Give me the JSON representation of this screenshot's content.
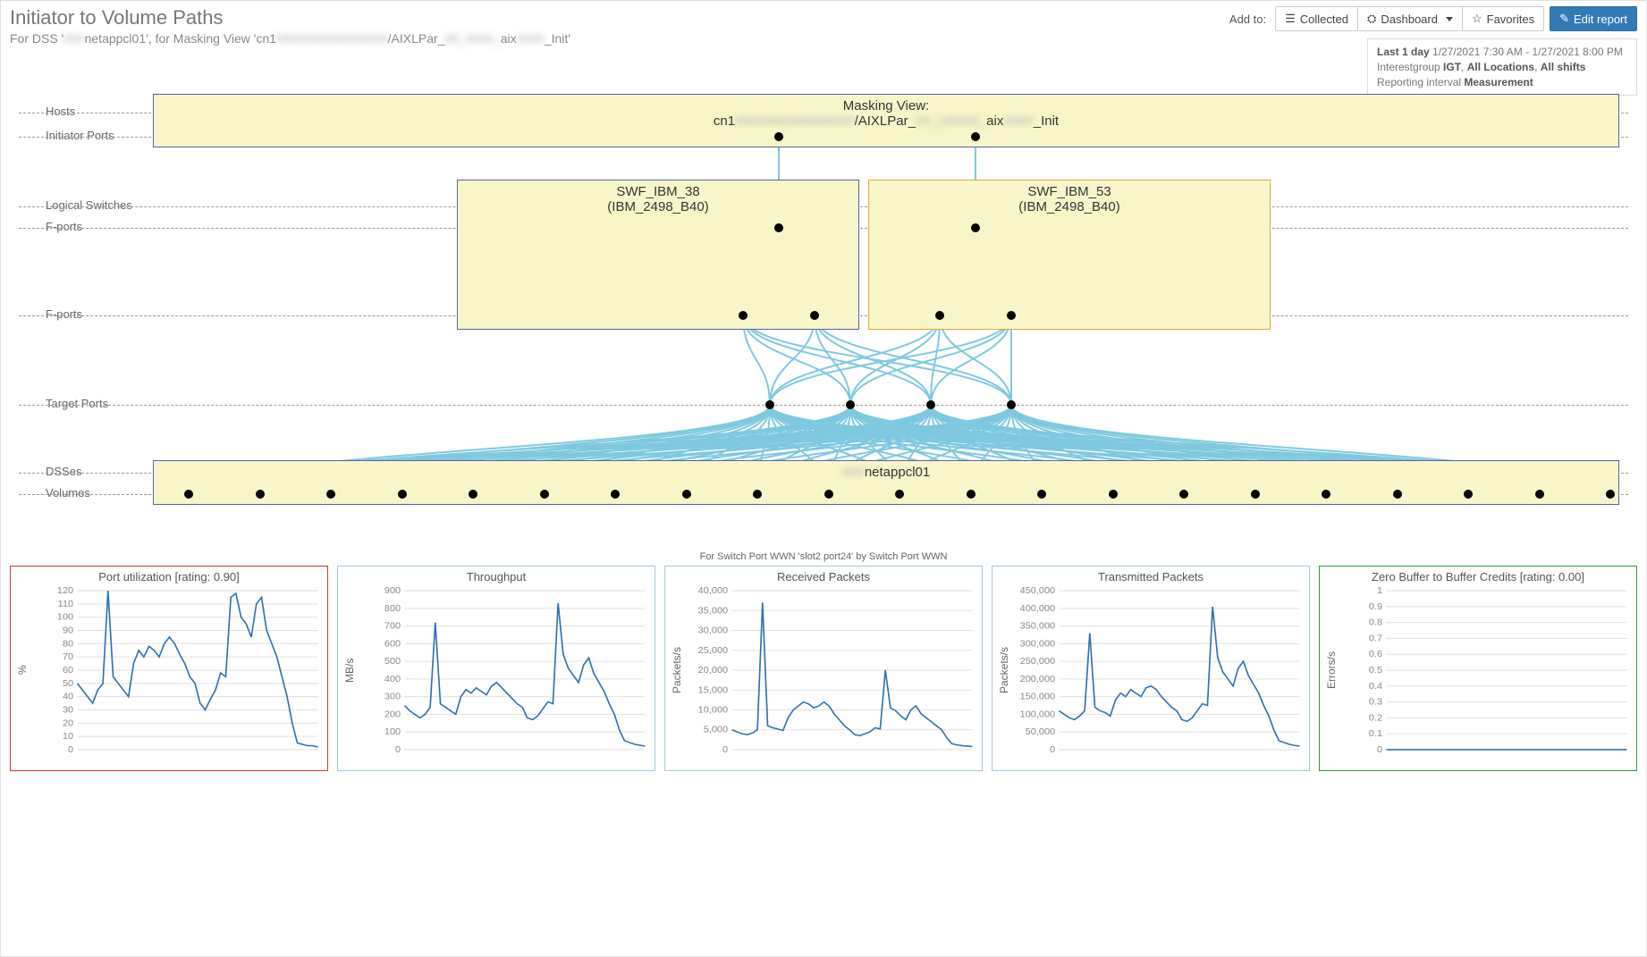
{
  "header": {
    "title": "Initiator to Volume Paths",
    "subtitle_prefix": "For DSS '",
    "subtitle_dss_blur": "###",
    "subtitle_dss": "netappcl01",
    "subtitle_mid": "', for Masking View 'cn1",
    "subtitle_mv_blur": "################",
    "subtitle_mv_mid": "/AIXLPar_",
    "subtitle_mv_blur2": "##_####_",
    "subtitle_mv_mid2": "aix",
    "subtitle_mv_blur3": "####",
    "subtitle_end": "_Init'",
    "addto": "Add to:",
    "btn_collected": "Collected",
    "btn_dashboard": "Dashboard",
    "btn_favorites": "Favorites",
    "btn_edit": "Edit report"
  },
  "info": {
    "l1_a": "Last 1 day ",
    "l1_b": "1/27/2021 7:30 AM - 1/27/2021 8:00 PM",
    "l2_a": "Interestgroup ",
    "l2_b": "IGT",
    "l2_c": ", ",
    "l2_d": "All Locations",
    "l2_e": ", ",
    "l2_f": "All shifts",
    "l3_a": "Reporting interval ",
    "l3_b": "Measurement"
  },
  "topology": {
    "rows": {
      "hosts": "Hosts",
      "initports": "Initiator Ports",
      "logsw": "Logical Switches",
      "fports1": "F-ports",
      "fports2": "F-ports",
      "tgtports": "Target Ports",
      "dsses": "DSSes",
      "volumes": "Volumes"
    },
    "mv_title": "Masking View:",
    "mv_name_a": "cn1",
    "mv_name_blur": "################",
    "mv_name_b": "/AIXLPar_",
    "mv_name_blur2": "##_U###A_",
    "mv_name_c": "aix",
    "mv_name_blur3": "####",
    "mv_name_d": "_Init",
    "sw1_a": "SWF_IBM_38",
    "sw1_b": "(IBM_2498_B40)",
    "sw2_a": "SWF_IBM_53",
    "sw2_b": "(IBM_2498_B40)",
    "dss_blur": "###",
    "dss": "netappcl01",
    "counts": {
      "initiator_ports": 2,
      "switches": 2,
      "fports_upper": 2,
      "fports_lower": 4,
      "target_ports": 4,
      "volumes": 21
    }
  },
  "chart_strip_header": "For Switch Port WWN 'slot2 port24' by Switch Port WWN",
  "chart_data": [
    {
      "type": "line",
      "title": "Port utilization [rating: 0.90]",
      "ylabel": "%",
      "ylim": [
        0,
        120
      ],
      "yticks": [
        0,
        10,
        20,
        30,
        40,
        50,
        60,
        70,
        80,
        90,
        100,
        110,
        120
      ],
      "border": "red",
      "values": [
        50,
        45,
        40,
        35,
        45,
        50,
        120,
        55,
        50,
        45,
        40,
        65,
        75,
        70,
        78,
        75,
        70,
        80,
        85,
        80,
        72,
        65,
        55,
        50,
        35,
        30,
        38,
        45,
        58,
        55,
        115,
        118,
        100,
        95,
        85,
        110,
        115,
        90,
        80,
        70,
        55,
        40,
        20,
        5,
        4,
        3,
        3,
        2
      ]
    },
    {
      "type": "line",
      "title": "Throughput",
      "ylabel": "MB/s",
      "ylim": [
        0,
        900
      ],
      "yticks": [
        0,
        100,
        200,
        300,
        400,
        500,
        600,
        700,
        800,
        900
      ],
      "border": "blue",
      "values": [
        250,
        220,
        200,
        180,
        200,
        240,
        720,
        260,
        240,
        220,
        200,
        300,
        340,
        320,
        350,
        330,
        310,
        360,
        380,
        350,
        320,
        290,
        260,
        240,
        180,
        170,
        190,
        230,
        270,
        260,
        830,
        540,
        460,
        420,
        380,
        480,
        520,
        430,
        380,
        330,
        260,
        200,
        110,
        50,
        40,
        30,
        25,
        20
      ]
    },
    {
      "type": "line",
      "title": "Received Packets",
      "ylabel": "Packets/s",
      "ylim": [
        0,
        40000
      ],
      "yticks": [
        0,
        5000,
        10000,
        15000,
        20000,
        25000,
        30000,
        35000,
        40000
      ],
      "border": "blue",
      "values": [
        5000,
        4500,
        4000,
        3800,
        4200,
        5000,
        37000,
        6000,
        5500,
        5200,
        4800,
        8000,
        10000,
        11000,
        12000,
        11500,
        10500,
        11000,
        12000,
        11000,
        9000,
        7500,
        6000,
        5000,
        3800,
        3500,
        4000,
        4500,
        5500,
        5200,
        20000,
        10500,
        9800,
        8500,
        7500,
        10000,
        11000,
        9000,
        8000,
        7000,
        6000,
        5000,
        3000,
        1500,
        1200,
        1000,
        900,
        800
      ]
    },
    {
      "type": "line",
      "title": "Transmitted Packets",
      "ylabel": "Packets/s",
      "ylim": [
        0,
        450000
      ],
      "yticks": [
        0,
        50000,
        100000,
        150000,
        200000,
        250000,
        300000,
        350000,
        400000,
        450000
      ],
      "border": "blue",
      "values": [
        110000,
        100000,
        90000,
        85000,
        95000,
        110000,
        330000,
        120000,
        110000,
        105000,
        95000,
        140000,
        160000,
        150000,
        170000,
        160000,
        150000,
        175000,
        180000,
        170000,
        150000,
        135000,
        120000,
        110000,
        85000,
        80000,
        90000,
        110000,
        130000,
        125000,
        405000,
        260000,
        220000,
        200000,
        180000,
        230000,
        250000,
        210000,
        185000,
        160000,
        125000,
        95000,
        55000,
        25000,
        20000,
        15000,
        12000,
        10000
      ]
    },
    {
      "type": "line",
      "title": "Zero Buffer to Buffer Credits [rating: 0.00]",
      "ylabel": "Errors/s",
      "ylim": [
        0,
        1
      ],
      "yticks": [
        0,
        0.1,
        0.2,
        0.3,
        0.4,
        0.5,
        0.6,
        0.7,
        0.8,
        0.9,
        1.0
      ],
      "border": "green",
      "values": [
        0,
        0,
        0,
        0,
        0,
        0,
        0,
        0,
        0,
        0,
        0,
        0,
        0,
        0,
        0,
        0,
        0,
        0,
        0,
        0,
        0,
        0,
        0,
        0,
        0,
        0,
        0,
        0,
        0,
        0,
        0,
        0,
        0,
        0,
        0,
        0,
        0,
        0,
        0,
        0,
        0,
        0,
        0,
        0,
        0,
        0,
        0,
        0
      ]
    }
  ]
}
